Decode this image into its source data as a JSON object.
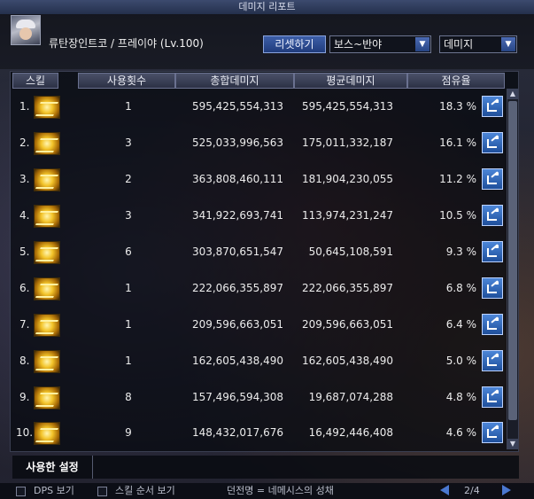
{
  "window": {
    "title": "데미지 리포트"
  },
  "header": {
    "character_name": "류탄장인트코 / 프레이야 (Lv.100)",
    "reset_label": "리셋하기",
    "boss_filter": "보스~반야",
    "metric_filter": "데미지",
    "dropdown_arrow": "▼"
  },
  "columns": {
    "skill": "스킬",
    "uses": "사용횟수",
    "total": "총합데미지",
    "avg": "평균데미지",
    "share": "점유율"
  },
  "rows": [
    {
      "rank": "1.",
      "uses": "1",
      "total": "595,425,554,313",
      "avg": "595,425,554,313",
      "share": "18.3 %"
    },
    {
      "rank": "2.",
      "uses": "3",
      "total": "525,033,996,563",
      "avg": "175,011,332,187",
      "share": "16.1 %"
    },
    {
      "rank": "3.",
      "uses": "2",
      "total": "363,808,460,111",
      "avg": "181,904,230,055",
      "share": "11.2 %"
    },
    {
      "rank": "4.",
      "uses": "3",
      "total": "341,922,693,741",
      "avg": "113,974,231,247",
      "share": "10.5 %"
    },
    {
      "rank": "5.",
      "uses": "6",
      "total": "303,870,651,547",
      "avg": "50,645,108,591",
      "share": "9.3 %"
    },
    {
      "rank": "6.",
      "uses": "1",
      "total": "222,066,355,897",
      "avg": "222,066,355,897",
      "share": "6.8 %"
    },
    {
      "rank": "7.",
      "uses": "1",
      "total": "209,596,663,051",
      "avg": "209,596,663,051",
      "share": "6.4 %"
    },
    {
      "rank": "8.",
      "uses": "1",
      "total": "162,605,438,490",
      "avg": "162,605,438,490",
      "share": "5.0 %"
    },
    {
      "rank": "9.",
      "uses": "8",
      "total": "157,496,594,308",
      "avg": "19,687,074,288",
      "share": "4.8 %"
    },
    {
      "rank": "10.",
      "uses": "9",
      "total": "148,432,017,676",
      "avg": "16,492,446,408",
      "share": "4.6 %"
    }
  ],
  "settings": {
    "used_settings_label": "사용한 설정"
  },
  "footer": {
    "dps_label": "DPS 보기",
    "skill_order_label": "스킬 순서 보기",
    "dungeon_label": "던전명 = 네메시스의 성채",
    "page": "2/4"
  },
  "scroll": {
    "up": "▲",
    "down": "▼"
  },
  "colors": {
    "accent": "#2f58b8",
    "panel": "#0a0c14"
  }
}
